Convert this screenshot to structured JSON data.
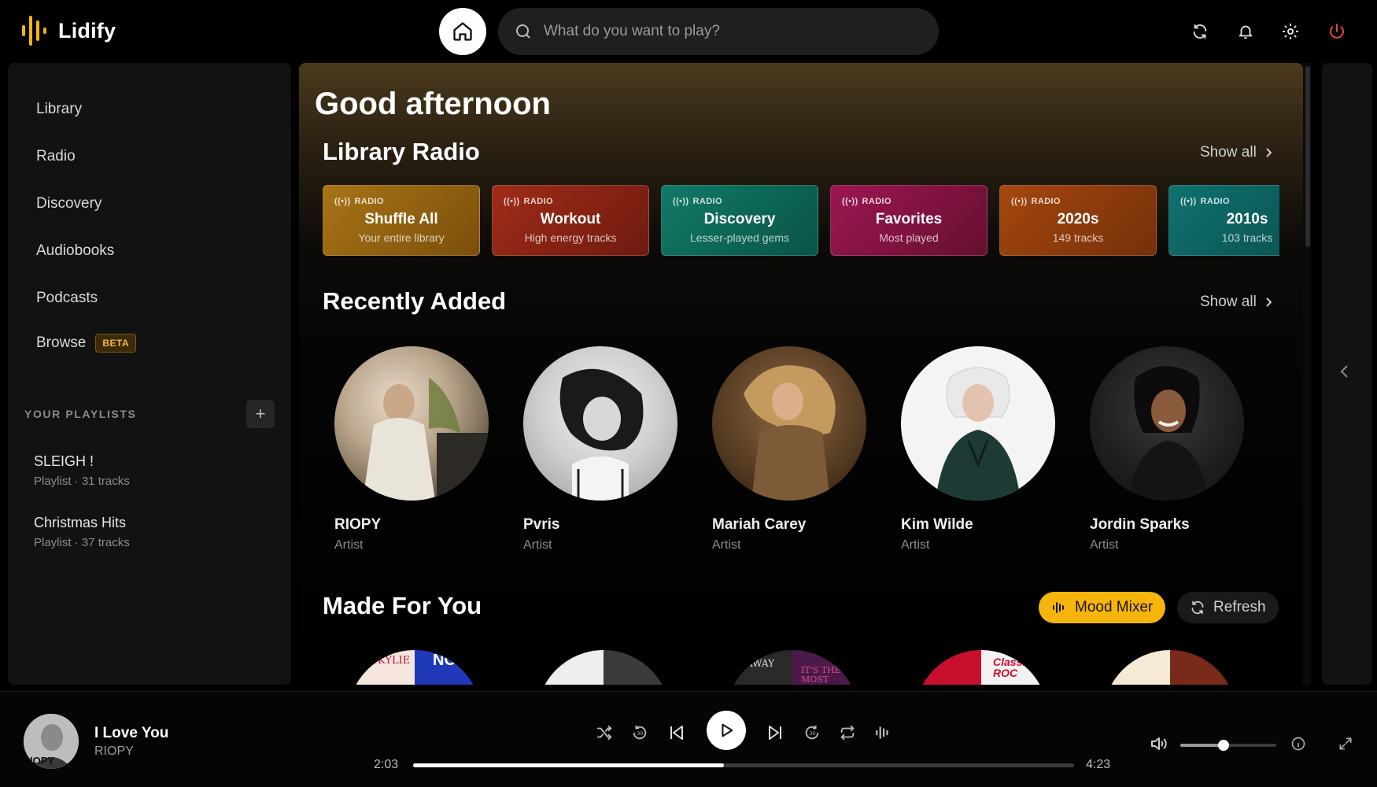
{
  "app": {
    "name": "Lidify",
    "accent": "#f5b50d"
  },
  "search": {
    "placeholder": "What do you want to play?"
  },
  "top_icons": [
    "refresh-icon",
    "bell-icon",
    "gear-icon",
    "power-icon"
  ],
  "sidebar": {
    "nav": [
      {
        "label": "Library"
      },
      {
        "label": "Radio"
      },
      {
        "label": "Discovery"
      },
      {
        "label": "Audiobooks"
      },
      {
        "label": "Podcasts"
      },
      {
        "label": "Browse",
        "badge": "BETA"
      }
    ],
    "playlists_header": "YOUR PLAYLISTS",
    "playlists": [
      {
        "title": "SLEIGH !",
        "meta": "Playlist · 31 tracks"
      },
      {
        "title": "Christmas Hits",
        "meta": "Playlist · 37 tracks"
      }
    ]
  },
  "main": {
    "greeting": "Good afternoon",
    "library_radio": {
      "title": "Library Radio",
      "show_all": "Show all",
      "cards": [
        {
          "tag": "RADIO",
          "title": "Shuffle All",
          "subtitle": "Your entire library",
          "color": "#9a6a12"
        },
        {
          "tag": "RADIO",
          "title": "Workout",
          "subtitle": "High energy tracks",
          "color": "#8f2416"
        },
        {
          "tag": "RADIO",
          "title": "Discovery",
          "subtitle": "Lesser-played gems",
          "color": "#0e6b5a"
        },
        {
          "tag": "RADIO",
          "title": "Favorites",
          "subtitle": "Most played",
          "color": "#8a1347"
        },
        {
          "tag": "RADIO",
          "title": "2020s",
          "subtitle": "149 tracks",
          "color": "#933d0c"
        },
        {
          "tag": "RADIO",
          "title": "2010s",
          "subtitle": "103 tracks",
          "color": "#0d6462"
        }
      ]
    },
    "recently_added": {
      "title": "Recently Added",
      "show_all": "Show all",
      "items": [
        {
          "name": "RIOPY",
          "role": "Artist"
        },
        {
          "name": "Pvris",
          "role": "Artist"
        },
        {
          "name": "Mariah Carey",
          "role": "Artist"
        },
        {
          "name": "Kim Wilde",
          "role": "Artist"
        },
        {
          "name": "Jordin Sparks",
          "role": "Artist"
        }
      ]
    },
    "made_for_you": {
      "title": "Made For You",
      "mood_mixer": "Mood Mixer",
      "refresh": "Refresh",
      "cover_texts": [
        "KYLIE",
        "NO",
        "AWAY",
        "IT'S THE MOST",
        "Classic ROC"
      ]
    }
  },
  "player": {
    "title": "I Love You",
    "artist": "RIOPY",
    "art_caption": "IOPY",
    "elapsed": "2:03",
    "duration": "4:23",
    "progress": 0.47,
    "volume": 0.45
  }
}
